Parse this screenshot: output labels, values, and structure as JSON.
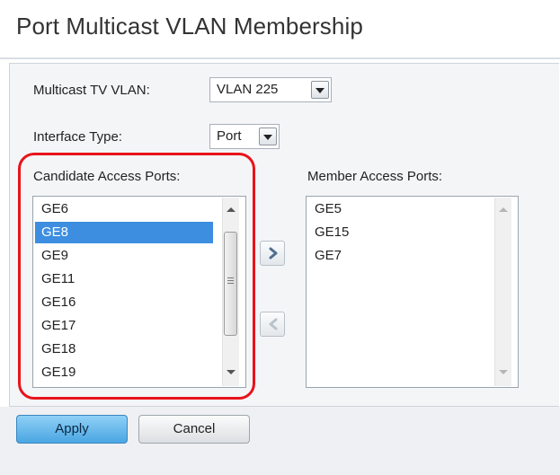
{
  "page": {
    "title": "Port Multicast VLAN Membership"
  },
  "form": {
    "multicast_vlan_label": "Multicast TV VLAN:",
    "multicast_vlan_value": "VLAN 225",
    "interface_type_label": "Interface Type:",
    "interface_type_value": "Port"
  },
  "candidate": {
    "label": "Candidate Access Ports:",
    "items": [
      "GE6",
      "GE8",
      "GE9",
      "GE11",
      "GE16",
      "GE17",
      "GE18",
      "GE19"
    ],
    "selected": "GE8"
  },
  "member": {
    "label": "Member Access Ports:",
    "items": [
      "GE5",
      "GE15",
      "GE7"
    ]
  },
  "buttons": {
    "apply": "Apply",
    "cancel": "Cancel"
  },
  "colors": {
    "selection": "#3d8ee0",
    "highlight": "#e8131b",
    "apply": "#4aa6e2"
  },
  "icons": {
    "add": "chevron-right-icon",
    "remove": "chevron-left-icon"
  }
}
